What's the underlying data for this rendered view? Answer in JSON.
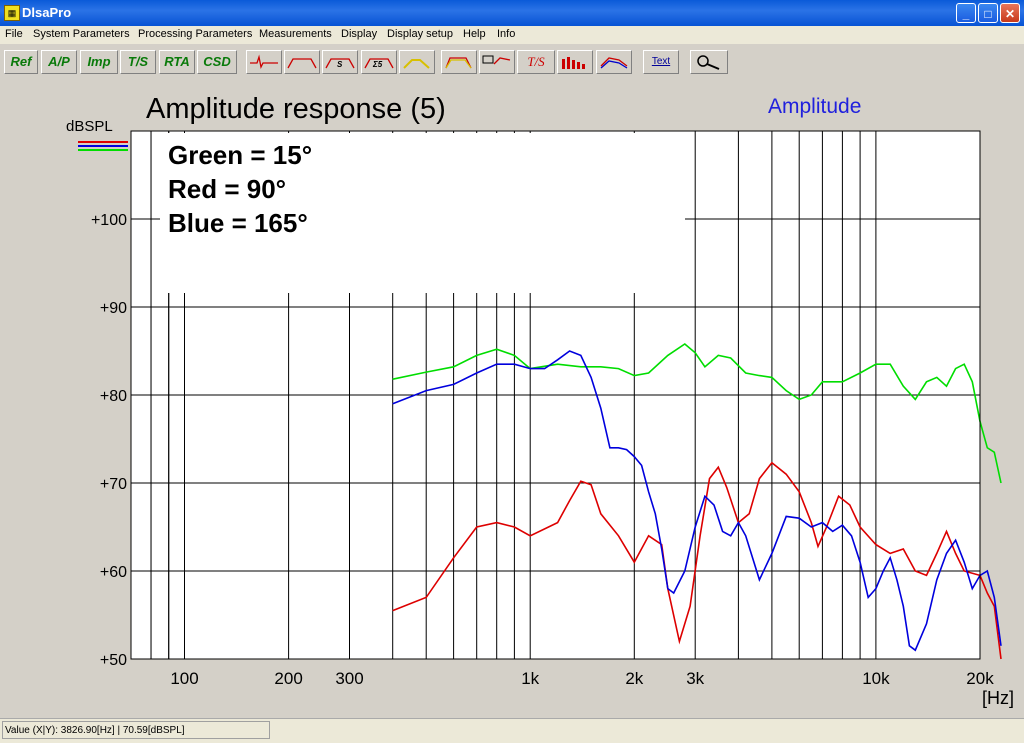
{
  "window": {
    "title": "DlsaPro",
    "min": "_",
    "max": "□",
    "close": "✕"
  },
  "menu": [
    "File",
    "System Parameters",
    "Processing Parameters",
    "Measurements",
    "Display",
    "Display setup",
    "Help",
    "Info"
  ],
  "toolbar": {
    "text_buttons": [
      "Ref",
      "A/P",
      "Imp",
      "T/S",
      "RTA",
      "CSD"
    ],
    "text_label": "Text",
    "ts_label": "T/S"
  },
  "status": {
    "value": "Value (X|Y): 3826.90[Hz] | 70.59[dBSPL]"
  },
  "chart_data": {
    "type": "line",
    "title": "Amplitude response (5)",
    "subtitle": "Amplitude",
    "ylabel": "dBSPL",
    "xlabel": "[Hz]",
    "x_scale": "log",
    "xlim": [
      70,
      20000
    ],
    "ylim": [
      50,
      110
    ],
    "x_ticks": [
      {
        "v": 100,
        "label": "100"
      },
      {
        "v": 200,
        "label": "200"
      },
      {
        "v": 300,
        "label": "300"
      },
      {
        "v": 1000,
        "label": "1k"
      },
      {
        "v": 2000,
        "label": "2k"
      },
      {
        "v": 3000,
        "label": "3k"
      },
      {
        "v": 10000,
        "label": "10k"
      },
      {
        "v": 20000,
        "label": "20k"
      }
    ],
    "y_ticks": [
      {
        "v": 50,
        "label": "+50"
      },
      {
        "v": 60,
        "label": "+60"
      },
      {
        "v": 70,
        "label": "+70"
      },
      {
        "v": 80,
        "label": "+80"
      },
      {
        "v": 90,
        "label": "+90"
      },
      {
        "v": 100,
        "label": "+100"
      }
    ],
    "annotations": [
      "Green = 15°",
      "Red = 90°",
      "Blue = 165°"
    ],
    "grid": true,
    "series": [
      {
        "color": "#00dd00",
        "points": [
          [
            400,
            81.8
          ],
          [
            500,
            82.6
          ],
          [
            600,
            83.2
          ],
          [
            700,
            84.5
          ],
          [
            800,
            85.2
          ],
          [
            900,
            84.5
          ],
          [
            1000,
            83.0
          ],
          [
            1200,
            83.5
          ],
          [
            1400,
            83.2
          ],
          [
            1600,
            83.2
          ],
          [
            1800,
            83.0
          ],
          [
            2000,
            82.2
          ],
          [
            2200,
            82.5
          ],
          [
            2500,
            84.5
          ],
          [
            2800,
            85.8
          ],
          [
            3000,
            84.8
          ],
          [
            3200,
            83.2
          ],
          [
            3500,
            84.5
          ],
          [
            3800,
            84.2
          ],
          [
            4200,
            82.5
          ],
          [
            4600,
            82.2
          ],
          [
            5000,
            82.0
          ],
          [
            5500,
            80.5
          ],
          [
            6000,
            79.5
          ],
          [
            6500,
            80.0
          ],
          [
            7000,
            81.5
          ],
          [
            8000,
            81.5
          ],
          [
            9000,
            82.5
          ],
          [
            10000,
            83.5
          ],
          [
            11000,
            83.5
          ],
          [
            12000,
            81.0
          ],
          [
            13000,
            79.5
          ],
          [
            14000,
            81.5
          ],
          [
            15000,
            82.0
          ],
          [
            16000,
            81.0
          ],
          [
            17000,
            83.0
          ],
          [
            18000,
            83.5
          ],
          [
            19000,
            81.5
          ],
          [
            20000,
            77.0
          ],
          [
            21000,
            74.0
          ],
          [
            22000,
            73.5
          ],
          [
            23000,
            70.0
          ]
        ]
      },
      {
        "color": "#dd0000",
        "points": [
          [
            400,
            55.5
          ],
          [
            500,
            57.0
          ],
          [
            600,
            61.5
          ],
          [
            700,
            65.0
          ],
          [
            800,
            65.5
          ],
          [
            900,
            65.0
          ],
          [
            1000,
            64.0
          ],
          [
            1200,
            65.5
          ],
          [
            1300,
            68.0
          ],
          [
            1400,
            70.2
          ],
          [
            1500,
            69.8
          ],
          [
            1600,
            66.5
          ],
          [
            1800,
            64.0
          ],
          [
            2000,
            61.0
          ],
          [
            2200,
            64.0
          ],
          [
            2400,
            63.0
          ],
          [
            2500,
            58.0
          ],
          [
            2700,
            52.0
          ],
          [
            2900,
            56.0
          ],
          [
            3100,
            64.0
          ],
          [
            3300,
            70.5
          ],
          [
            3500,
            71.8
          ],
          [
            3700,
            69.5
          ],
          [
            4000,
            65.5
          ],
          [
            4300,
            66.5
          ],
          [
            4600,
            70.5
          ],
          [
            5000,
            72.3
          ],
          [
            5500,
            71.0
          ],
          [
            6000,
            69.0
          ],
          [
            6500,
            65.5
          ],
          [
            6800,
            62.8
          ],
          [
            7200,
            65.0
          ],
          [
            7800,
            68.5
          ],
          [
            8400,
            67.5
          ],
          [
            9000,
            65.0
          ],
          [
            10000,
            63.0
          ],
          [
            11000,
            62.0
          ],
          [
            12000,
            62.5
          ],
          [
            13000,
            60.0
          ],
          [
            14000,
            59.5
          ],
          [
            15000,
            62.0
          ],
          [
            16000,
            64.5
          ],
          [
            17000,
            62.0
          ],
          [
            18000,
            60.0
          ],
          [
            20000,
            59.5
          ],
          [
            21000,
            57.5
          ],
          [
            22000,
            56.0
          ],
          [
            23000,
            50.0
          ]
        ]
      },
      {
        "color": "#0000dd",
        "points": [
          [
            400,
            79.0
          ],
          [
            500,
            80.5
          ],
          [
            600,
            81.2
          ],
          [
            700,
            82.5
          ],
          [
            800,
            83.5
          ],
          [
            900,
            83.5
          ],
          [
            1000,
            83.0
          ],
          [
            1100,
            83.0
          ],
          [
            1200,
            84.0
          ],
          [
            1300,
            85.0
          ],
          [
            1400,
            84.5
          ],
          [
            1500,
            82.0
          ],
          [
            1600,
            78.5
          ],
          [
            1700,
            74.0
          ],
          [
            1800,
            74.0
          ],
          [
            1900,
            73.8
          ],
          [
            2000,
            73.0
          ],
          [
            2100,
            72.0
          ],
          [
            2200,
            69.0
          ],
          [
            2300,
            66.5
          ],
          [
            2400,
            62.5
          ],
          [
            2500,
            58.0
          ],
          [
            2600,
            57.5
          ],
          [
            2800,
            60.0
          ],
          [
            3000,
            65.0
          ],
          [
            3200,
            68.5
          ],
          [
            3400,
            67.5
          ],
          [
            3600,
            64.5
          ],
          [
            3800,
            64.0
          ],
          [
            4000,
            65.5
          ],
          [
            4200,
            64.0
          ],
          [
            4600,
            59.0
          ],
          [
            5000,
            62.0
          ],
          [
            5500,
            66.2
          ],
          [
            6000,
            66.0
          ],
          [
            6500,
            65.0
          ],
          [
            7000,
            65.5
          ],
          [
            7500,
            64.5
          ],
          [
            8000,
            65.2
          ],
          [
            8500,
            64.0
          ],
          [
            9000,
            61.0
          ],
          [
            9500,
            57.0
          ],
          [
            10000,
            58.0
          ],
          [
            10500,
            60.0
          ],
          [
            11000,
            61.5
          ],
          [
            11500,
            59.0
          ],
          [
            12000,
            56.0
          ],
          [
            12500,
            51.5
          ],
          [
            13000,
            51.0
          ],
          [
            14000,
            54.0
          ],
          [
            15000,
            59.0
          ],
          [
            16000,
            62.0
          ],
          [
            17000,
            63.5
          ],
          [
            18000,
            61.0
          ],
          [
            19000,
            58.0
          ],
          [
            20000,
            59.5
          ],
          [
            21000,
            60.0
          ],
          [
            22000,
            57.0
          ],
          [
            23000,
            51.5
          ]
        ]
      }
    ]
  }
}
